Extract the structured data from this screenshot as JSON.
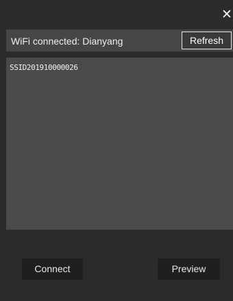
{
  "window": {
    "close_glyph": "✕"
  },
  "status": {
    "text": "WiFi connected: Dianyang",
    "refresh_label": "Refresh"
  },
  "ssid_list": {
    "items": [
      "SSID201910000026"
    ]
  },
  "footer": {
    "connect_label": "Connect",
    "preview_label": "Preview"
  },
  "colors": {
    "background": "#2b2b2b",
    "status_bar": "#464646",
    "list_panel": "#4a4a4a",
    "button": "#1f1f1f",
    "text": "#ffffff"
  }
}
